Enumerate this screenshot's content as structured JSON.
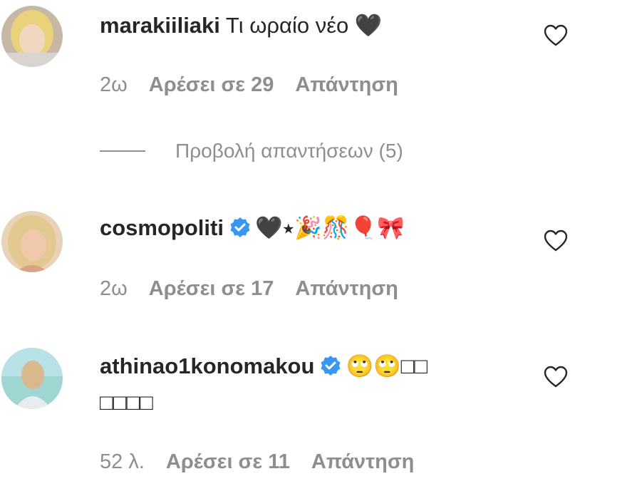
{
  "comments": [
    {
      "username": "marakiiliaki",
      "text": "Τι ωραίο νέο 🖤",
      "verified": false,
      "time": "2ω",
      "likes": "Αρέσει σε 29",
      "reply": "Απάντηση"
    },
    {
      "username": "cosmopoliti",
      "text": "🖤⭑🎉🎊🎈🎀",
      "verified": true,
      "time": "2ω",
      "likes": "Αρέσει σε 17",
      "reply": "Απάντηση"
    },
    {
      "username": "athinao1konomakou",
      "text": "🙄🙄□□",
      "text_line2": "□□□□",
      "verified": true,
      "time": "52 λ.",
      "likes": "Αρέσει σε 11",
      "reply": "Απάντηση"
    }
  ],
  "view_replies": "Προβολή απαντήσεων (5)",
  "colors": {
    "text": "#262626",
    "secondary": "#8e8e8e",
    "verified": "#3897f0"
  },
  "icons": {
    "like": "heart-outline-icon",
    "verified": "verified-badge-icon"
  }
}
